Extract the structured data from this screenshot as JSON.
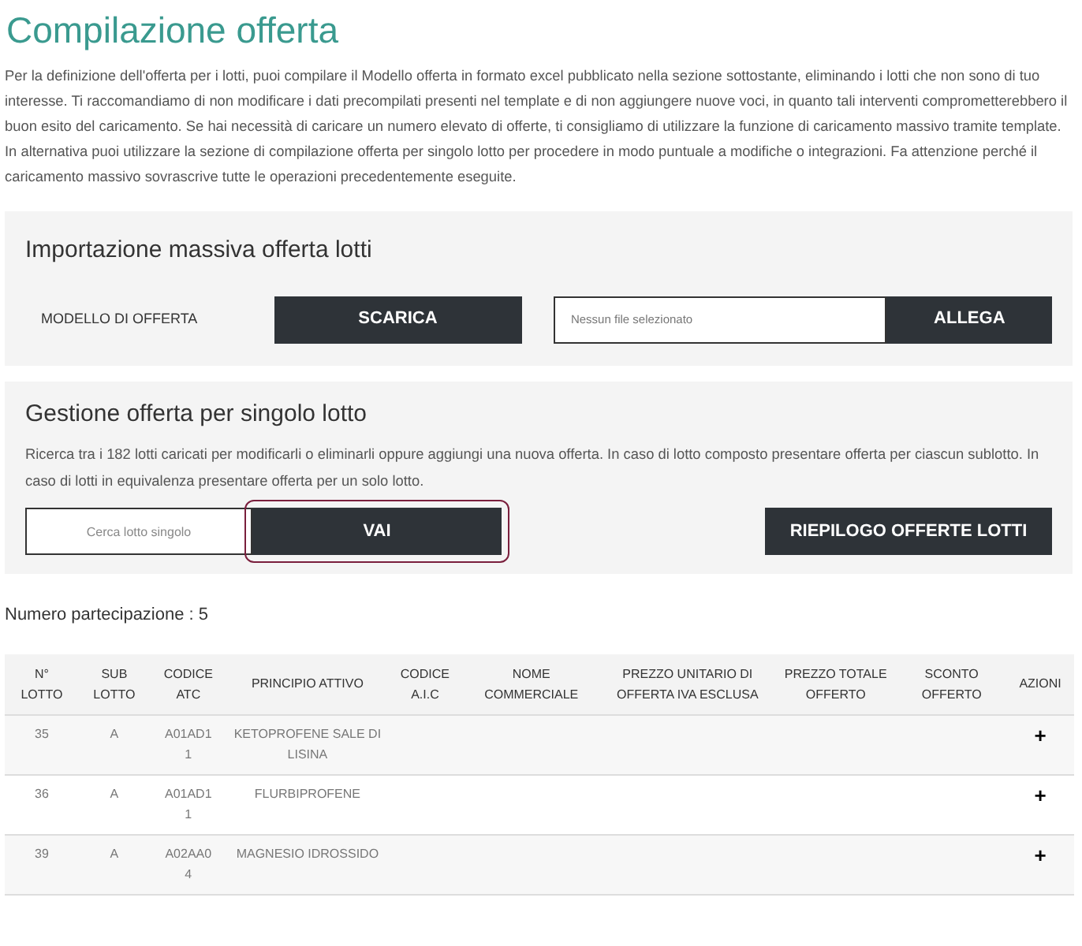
{
  "title": "Compilazione offerta",
  "intro": "Per la definizione dell'offerta per i lotti, puoi compilare il Modello offerta in formato excel pubblicato nella sezione sottostante, eliminando i lotti che non sono di tuo interesse. Ti raccomandiamo di non modificare i dati precompilati presenti nel template e di non aggiungere nuove voci, in quanto tali interventi comprometterebbero il buon esito del caricamento. Se hai necessità di caricare un numero elevato di offerte, ti consigliamo di utilizzare la funzione di caricamento massivo tramite template. In alternativa puoi utilizzare la sezione di compilazione offerta per singolo lotto per procedere in modo puntuale a modifiche o integrazioni. Fa attenzione perché il caricamento massivo sovrascrive tutte le operazioni precedentemente eseguite.",
  "import_section": {
    "heading": "Importazione massiva offerta lotti",
    "label": "MODELLO DI OFFERTA",
    "download_button": "SCARICA",
    "file_field": {
      "placeholder": "Nessun file selezionato"
    },
    "attach_button": "ALLEGA"
  },
  "single_section": {
    "heading": "Gestione offerta per singolo lotto",
    "description": "Ricerca tra i 182 lotti caricati per modificarli o eliminarli oppure aggiungi una nuova offerta. In caso di lotto composto presentare offerta per ciascun sublotto. In caso di lotti in equivalenza presentare offerta per un solo lotto.",
    "search": {
      "placeholder": "Cerca lotto singolo"
    },
    "go_button": {
      "label": "VAI",
      "focused": true
    },
    "summary_button": "RIEPILOGO OFFERTE LOTTI"
  },
  "participation": "Numero partecipazione : 5",
  "table": {
    "columns": [
      [
        "N°",
        "LOTTO"
      ],
      [
        "SUB",
        "LOTTO"
      ],
      [
        "CODICE",
        "ATC"
      ],
      [
        "PRINCIPIO ATTIVO"
      ],
      [
        "CODICE",
        "A.I.C"
      ],
      [
        "NOME",
        "COMMERCIALE"
      ],
      [
        "PREZZO UNITARIO DI",
        "OFFERTA IVA ESCLUSA"
      ],
      [
        "PREZZO TOTALE",
        "OFFERTO"
      ],
      [
        "SCONTO",
        "OFFERTO"
      ],
      [
        "AZIONI"
      ]
    ],
    "rows": [
      {
        "lotto": "35",
        "sub": "A",
        "atc": "A01AD11",
        "principio": "KETOPROFENE SALE DI LISINA",
        "action": "+"
      },
      {
        "lotto": "36",
        "sub": "A",
        "atc": "A01AD11",
        "principio": "FLURBIPROFENE",
        "action": "+"
      },
      {
        "lotto": "39",
        "sub": "A",
        "atc": "A02AA04",
        "principio": "MAGNESIO IDROSSIDO",
        "action": "+"
      }
    ]
  }
}
